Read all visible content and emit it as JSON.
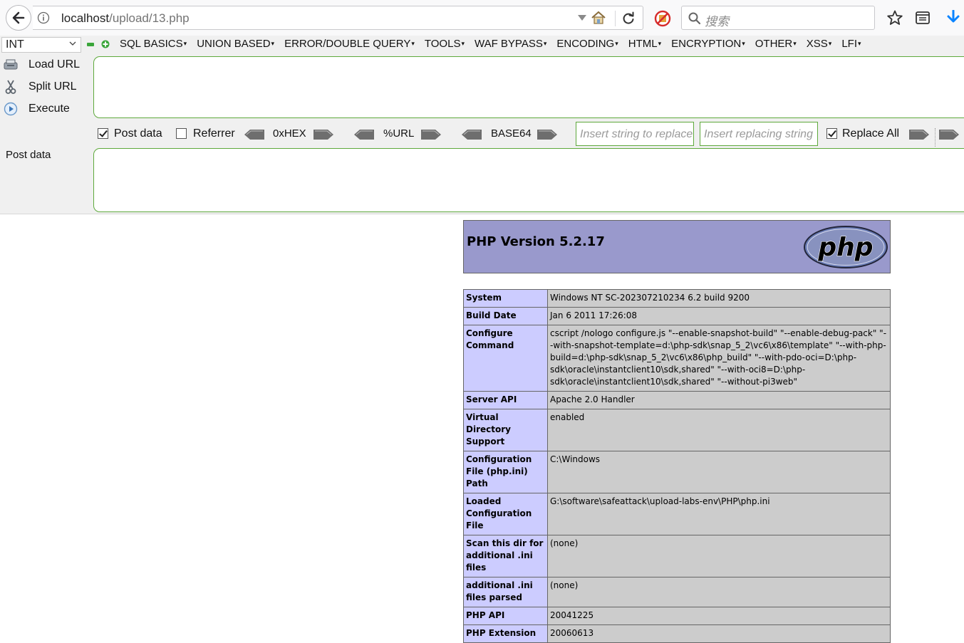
{
  "browser": {
    "url_host": "localhost",
    "url_path": "/upload/13.php",
    "search_placeholder": "搜索"
  },
  "hackbar": {
    "select_value": "INT",
    "menus": [
      "SQL BASICS",
      "UNION BASED",
      "ERROR/DOUBLE QUERY",
      "TOOLS",
      "WAF BYPASS",
      "ENCODING",
      "HTML",
      "ENCRYPTION",
      "OTHER",
      "XSS",
      "LFI"
    ],
    "load_url": "Load URL",
    "split_url": "Split URL",
    "execute": "Execute",
    "post_data_checkbox": "Post data",
    "post_data_checked": true,
    "referrer_checkbox": "Referrer",
    "referrer_checked": false,
    "enc_hex": "0xHEX",
    "enc_url": "%URL",
    "enc_base64": "BASE64",
    "replace_placeholder": "Insert string to replace",
    "replacing_placeholder": "Insert replacing string",
    "replace_all": "Replace All",
    "replace_all_checked": true,
    "post_data_label": "Post data",
    "url_value": "",
    "post_value": ""
  },
  "phpinfo": {
    "title": "PHP Version 5.2.17",
    "logo_text": "php",
    "rows": [
      {
        "key": "System",
        "value": "Windows NT SC-202307210234 6.2 build 9200"
      },
      {
        "key": "Build Date",
        "value": "Jan 6 2011 17:26:08"
      },
      {
        "key": "Configure Command",
        "value": "cscript /nologo configure.js \"--enable-snapshot-build\" \"--enable-debug-pack\" \"--with-snapshot-template=d:\\php-sdk\\snap_5_2\\vc6\\x86\\template\" \"--with-php-build=d:\\php-sdk\\snap_5_2\\vc6\\x86\\php_build\" \"--with-pdo-oci=D:\\php-sdk\\oracle\\instantclient10\\sdk,shared\" \"--with-oci8=D:\\php-sdk\\oracle\\instantclient10\\sdk,shared\" \"--without-pi3web\""
      },
      {
        "key": "Server API",
        "value": "Apache 2.0 Handler"
      },
      {
        "key": "Virtual Directory Support",
        "value": "enabled"
      },
      {
        "key": "Configuration File (php.ini) Path",
        "value": "C:\\Windows"
      },
      {
        "key": "Loaded Configuration File",
        "value": "G:\\software\\safeattack\\upload-labs-env\\PHP\\php.ini"
      },
      {
        "key": "Scan this dir for additional .ini files",
        "value": "(none)"
      },
      {
        "key": "additional .ini files parsed",
        "value": "(none)"
      },
      {
        "key": "PHP API",
        "value": "20041225"
      },
      {
        "key": "PHP Extension",
        "value": "20060613"
      }
    ]
  }
}
